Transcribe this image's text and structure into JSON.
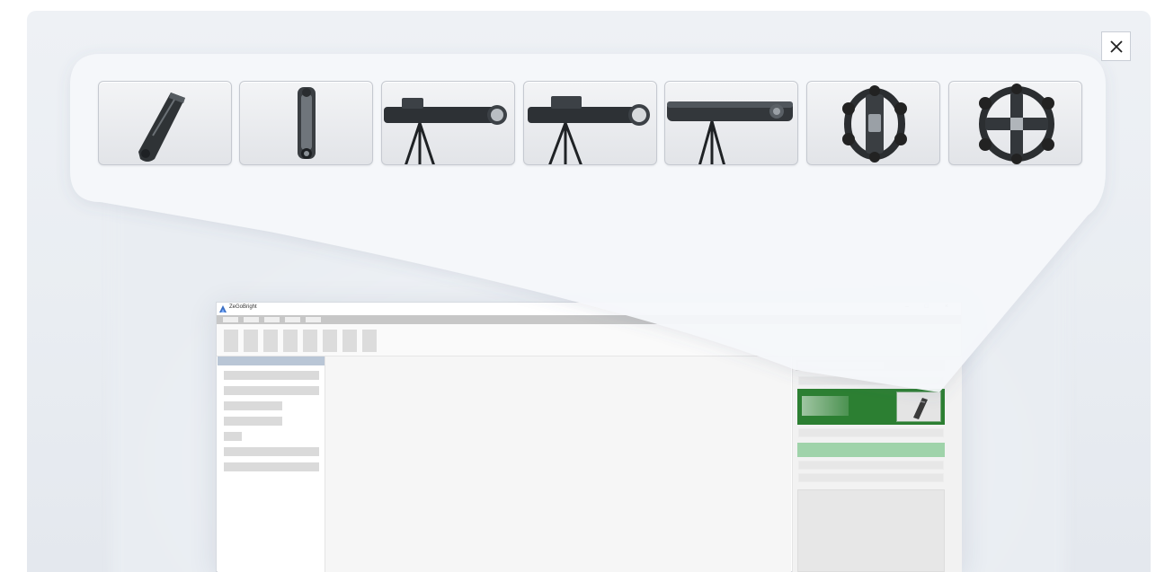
{
  "dialog": {
    "close_icon": "close-icon"
  },
  "devices": [
    {
      "name": "handheld-scanner-diagonal-icon"
    },
    {
      "name": "handheld-scanner-vertical-icon"
    },
    {
      "name": "tracker-tripod-1-icon"
    },
    {
      "name": "tracker-tripod-2-icon"
    },
    {
      "name": "tracker-tripod-3-icon"
    },
    {
      "name": "probe-sphere-1-icon"
    },
    {
      "name": "probe-sphere-2-icon"
    }
  ],
  "app_window": {
    "title": "ZeGoBright",
    "window_controls": "– □ ×",
    "selected_device_highlight_color": "#2c7f32",
    "secondary_highlight_color": "#9fd3aa"
  }
}
